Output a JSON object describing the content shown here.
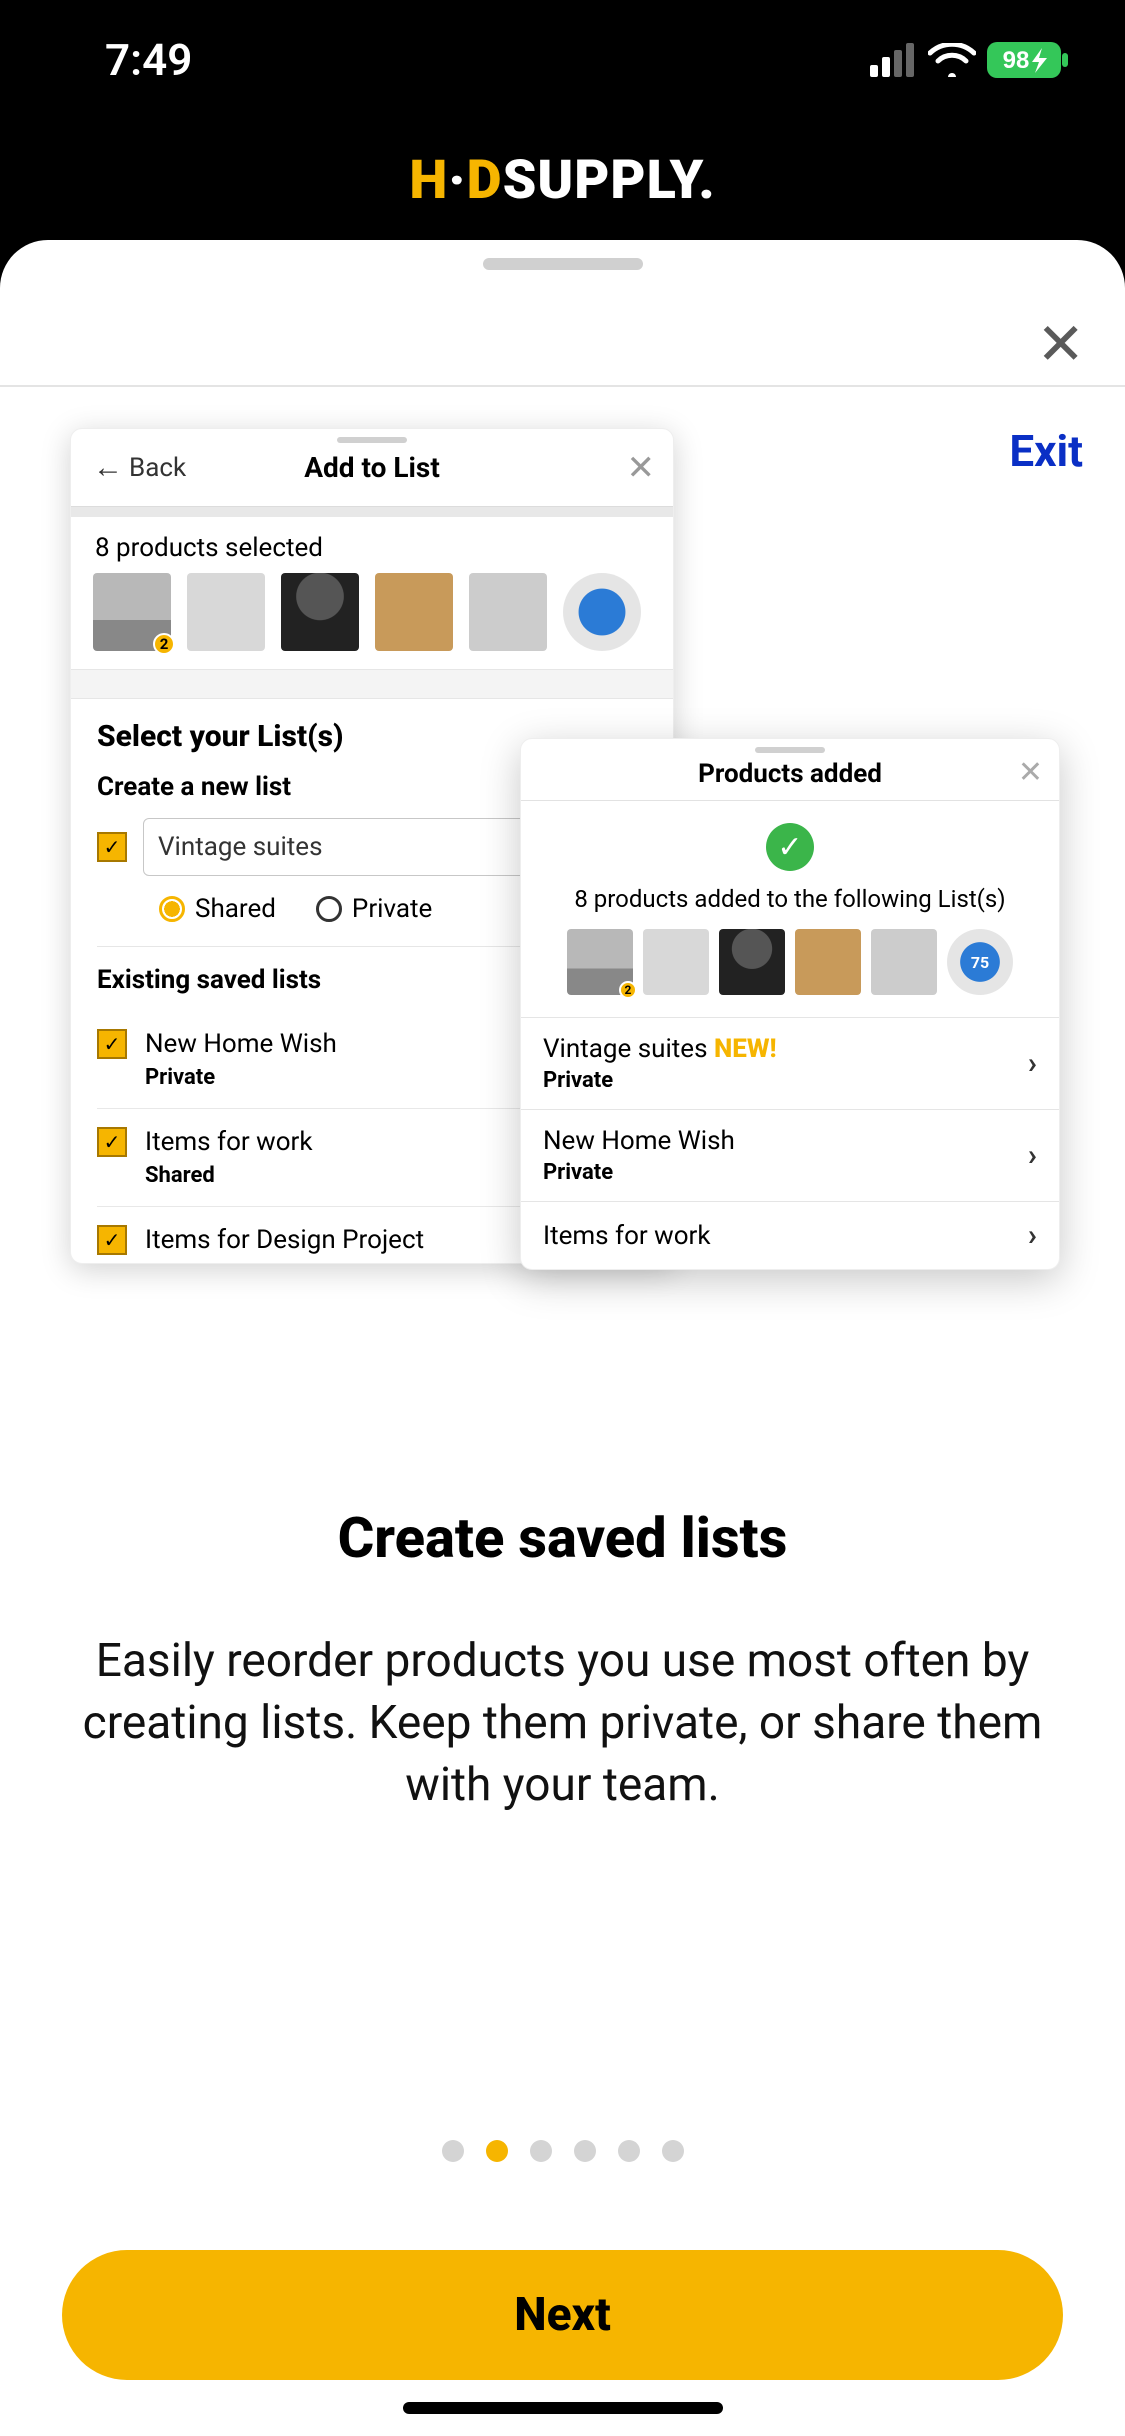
{
  "statusbar": {
    "time": "7:49",
    "battery": "98"
  },
  "logo": {
    "h": "H",
    "d": "D",
    "rest": "SUPPLY"
  },
  "sheet": {
    "exit": "Exit"
  },
  "cardA": {
    "back": "Back",
    "title": "Add to List",
    "selected": "8 products selected",
    "select_heading": "Select your List(s)",
    "create_label": "Create a new list",
    "new_list_name": "Vintage suites",
    "shared": "Shared",
    "private": "Private",
    "existing_heading": "Existing saved lists",
    "existing": [
      {
        "title": "New Home Wish",
        "sub": "Private"
      },
      {
        "title": "Items for work",
        "sub": "Shared"
      },
      {
        "title": "Items for Design Project",
        "sub": ""
      }
    ],
    "badge_count": "2"
  },
  "cardB": {
    "title": "Products added",
    "added_line": "8 products added to the following List(s)",
    "rows": [
      {
        "name": "Vintage suites",
        "tag": "NEW!",
        "sub": "Private"
      },
      {
        "name": "New Home Wish",
        "tag": "",
        "sub": "Private"
      },
      {
        "name": "Items for work",
        "tag": "",
        "sub": ""
      }
    ],
    "badge_count": "2",
    "nest_value": "75"
  },
  "onboard": {
    "headline": "Create saved lists",
    "body": "Easily reorder products you use most often by creating lists. Keep them private, or share them with your team.",
    "next": "Next"
  },
  "pager": {
    "total": 6,
    "active_index": 1
  }
}
